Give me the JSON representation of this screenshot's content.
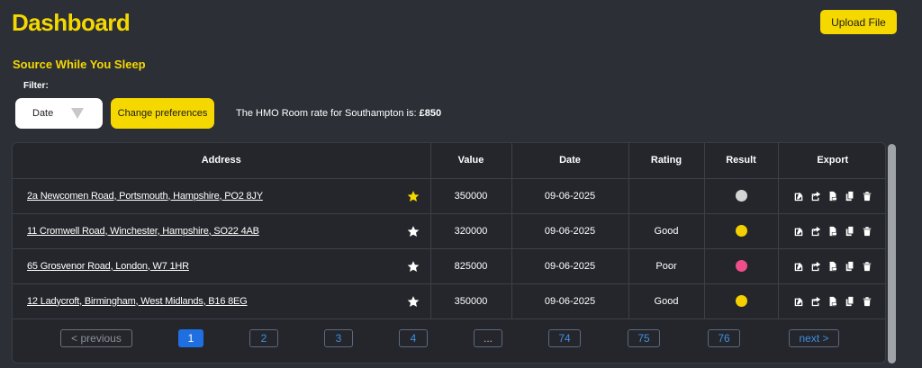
{
  "header": {
    "title": "Dashboard",
    "upload_label": "Upload File"
  },
  "section": {
    "title": "Source While You Sleep"
  },
  "filter": {
    "label": "Filter:",
    "selected": "Date",
    "preferences_label": "Change preferences"
  },
  "rate": {
    "prefix": "The HMO Room rate for Southampton is: ",
    "value": "£850"
  },
  "table": {
    "columns": [
      "Address",
      "Value",
      "Date",
      "Rating",
      "Result",
      "Export"
    ],
    "rows": [
      {
        "address": "2a Newcomen Road, Portsmouth, Hampshire, PO2 8JY",
        "starred": true,
        "value": "350000",
        "date": "09-06-2025",
        "rating": "",
        "result_color": "#d4d4d4"
      },
      {
        "address": "11 Cromwell Road, Winchester, Hampshire, SO22 4AB",
        "starred": false,
        "value": "320000",
        "date": "09-06-2025",
        "rating": "Good",
        "result_color": "#f5d000"
      },
      {
        "address": "65 Grosvenor Road, London, W7 1HR",
        "starred": false,
        "value": "825000",
        "date": "09-06-2025",
        "rating": "Poor",
        "result_color": "#ee4f8a"
      },
      {
        "address": "12 Ladycroft, Birmingham, West Midlands, B16 8EG",
        "starred": false,
        "value": "350000",
        "date": "09-06-2025",
        "rating": "Good",
        "result_color": "#f5d000"
      }
    ],
    "export_icons": [
      "edit-icon",
      "share-icon",
      "pdf-icon",
      "copy-icon",
      "trash-icon"
    ]
  },
  "pagination": {
    "previous": "< previous",
    "pages": [
      "1",
      "2",
      "3",
      "4",
      "...",
      "74",
      "75",
      "76"
    ],
    "current": "1",
    "next": "next >"
  },
  "colors": {
    "accent": "#f5d800",
    "background": "#2c2f36",
    "table_bg": "#24262b",
    "link_blue": "#3d8fe0",
    "active_page": "#1f6fe0"
  }
}
